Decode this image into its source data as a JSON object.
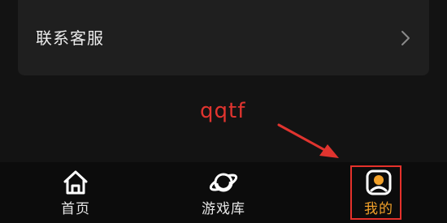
{
  "card": {
    "label": "联系客服",
    "chevron_icon": "chevron-right-icon"
  },
  "annotation": {
    "text": "qqtf",
    "color": "#e0342f"
  },
  "tabbar": {
    "tabs": [
      {
        "label": "首页",
        "icon": "home-icon",
        "active": false
      },
      {
        "label": "游戏库",
        "icon": "planet-icon",
        "active": false
      },
      {
        "label": "我的",
        "icon": "user-icon",
        "active": true
      }
    ],
    "active_color": "#f2a12a"
  },
  "colors": {
    "background": "#131313",
    "card": "#1f1f1f",
    "highlight": "#e5312b"
  }
}
